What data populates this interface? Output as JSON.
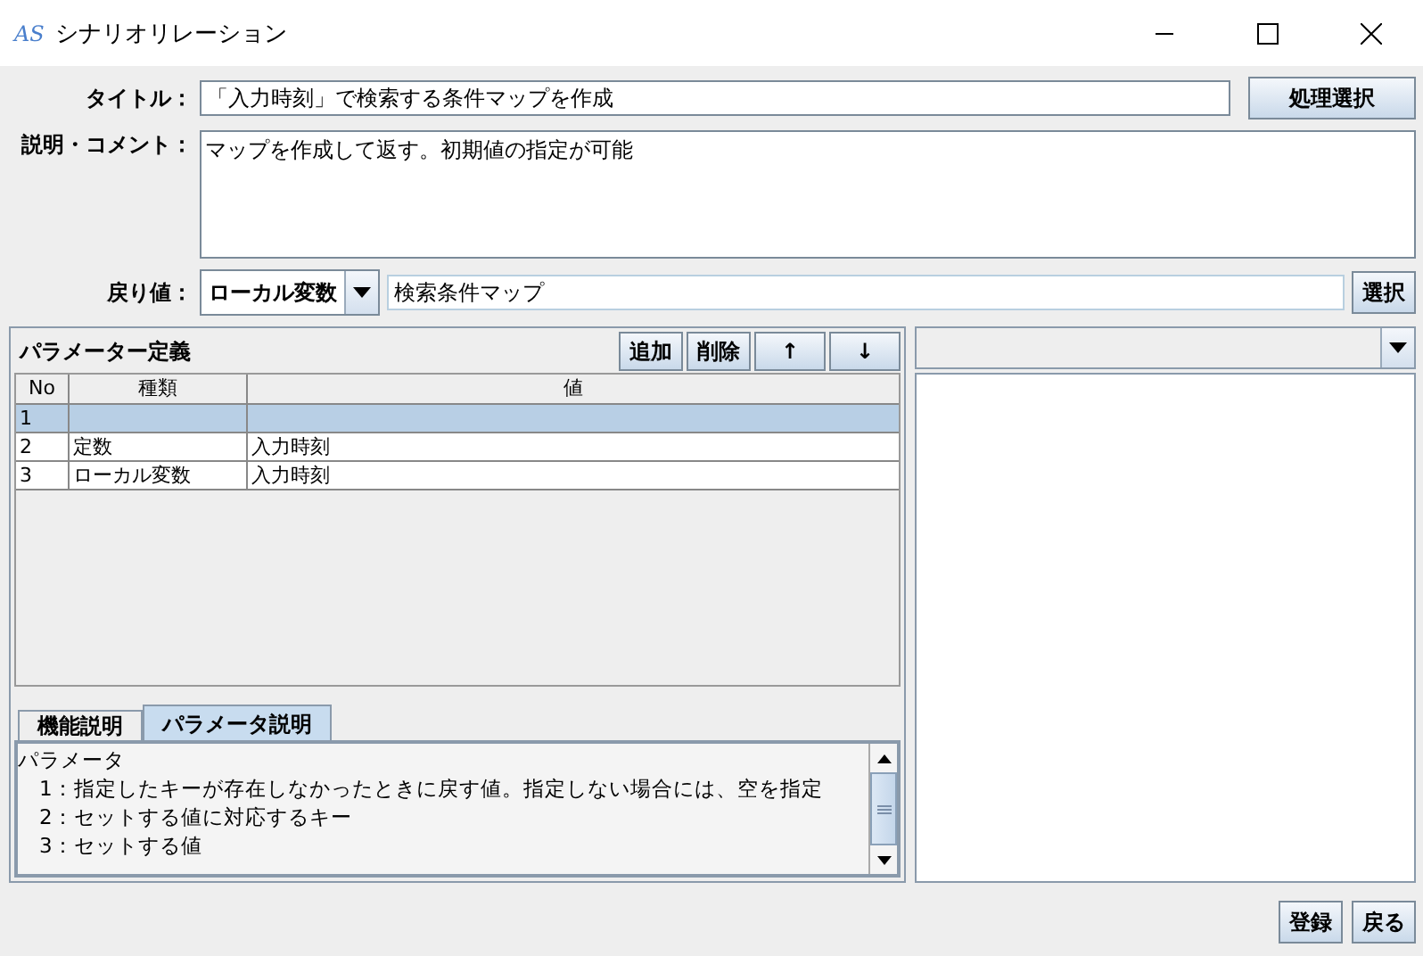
{
  "window": {
    "logo": "AS",
    "title": "シナリオリレーション"
  },
  "form": {
    "title_label": "タイトル：",
    "title_value": "「入力時刻」で検索する条件マップを作成",
    "process_button": "処理選択",
    "description_label": "説明・コメント：",
    "description_value": "マップを作成して返す。初期値の指定が可能",
    "return_label": "戻り値：",
    "return_type": "ローカル変数",
    "return_value": "検索条件マップ",
    "select_button": "選択"
  },
  "parameters": {
    "title": "パラメーター定義",
    "buttons": [
      "追加",
      "削除",
      "↑",
      "↓"
    ],
    "columns": [
      "No",
      "種類",
      "値"
    ],
    "rows": [
      {
        "cells": [
          "1",
          "",
          ""
        ],
        "selected": true
      },
      {
        "cells": [
          "2",
          "定数",
          "入力時刻"
        ],
        "selected": false
      },
      {
        "cells": [
          "3",
          "ローカル変数",
          "入力時刻"
        ],
        "selected": false
      }
    ]
  },
  "tabs": [
    {
      "label": "機能説明",
      "selected": false
    },
    {
      "label": "パラメータ説明",
      "selected": true
    }
  ],
  "help_lines": [
    "パラメータ",
    "　1：指定したキーが存在しなかったときに戻す値。指定しない場合には、空を指定",
    "　2：セットする値に対応するキー",
    "　3：セットする値"
  ],
  "footer_buttons": [
    "登録",
    "戻る"
  ]
}
